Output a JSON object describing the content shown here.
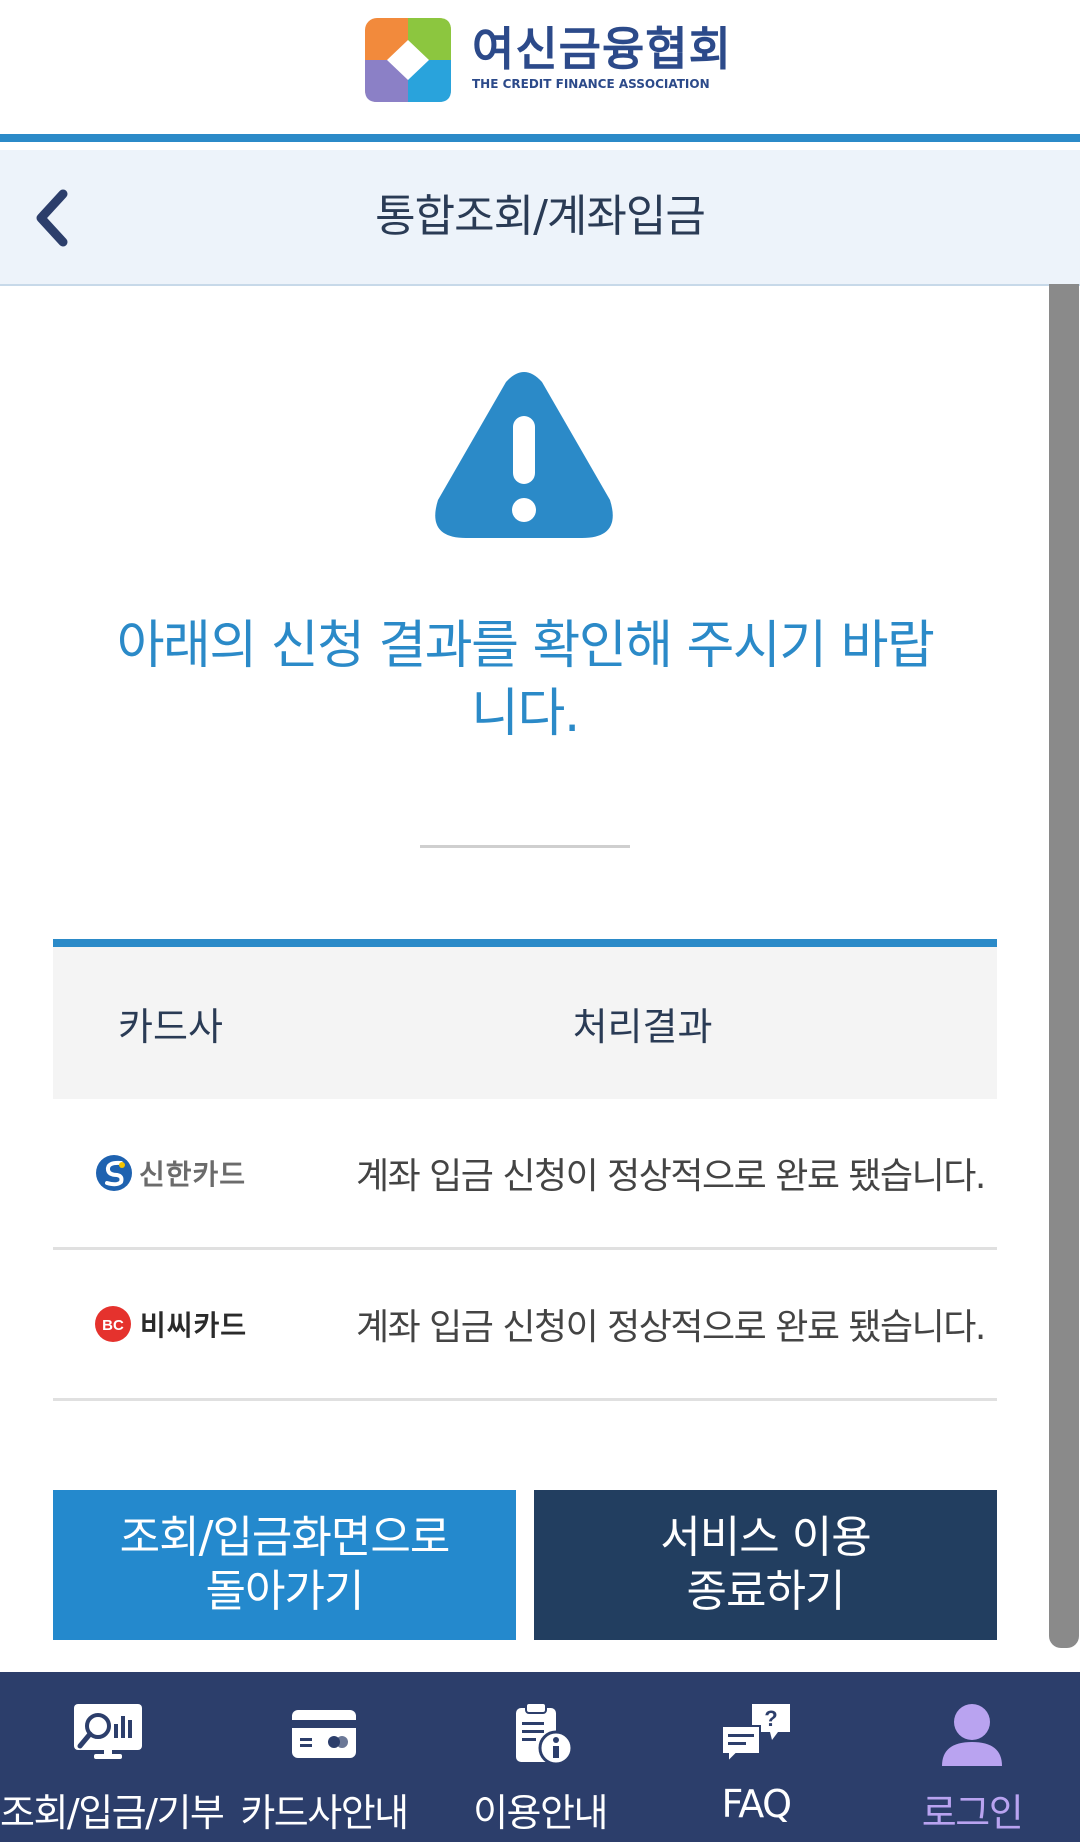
{
  "header": {
    "logo_text_kr": "여신금융협회",
    "logo_text_en": "THE CREDIT FINANCE ASSOCIATION"
  },
  "titlebar": {
    "title": "통합조회/계좌입금"
  },
  "main": {
    "message": "아래의 신청 결과를 확인해 주시기 바랍니다."
  },
  "table": {
    "headers": {
      "company": "카드사",
      "result": "처리결과"
    },
    "rows": [
      {
        "company": "신한카드",
        "result": "계좌 입금 신청이 정상적으로 완료 됐습니다."
      },
      {
        "company": "비씨카드",
        "result": "계좌 입금 신청이 정상적으로 완료 됐습니다."
      }
    ]
  },
  "buttons": {
    "back_to_search": "조회/입금화면으로 돌아가기",
    "end_service": "서비스 이용 종료하기"
  },
  "bottom_nav": {
    "items": [
      {
        "label": "조회/입금/기부",
        "icon": "search-chart-icon"
      },
      {
        "label": "카드사안내",
        "icon": "card-icon"
      },
      {
        "label": "이용안내",
        "icon": "info-clipboard-icon"
      },
      {
        "label": "FAQ",
        "icon": "faq-icon"
      },
      {
        "label": "로그인",
        "icon": "user-icon"
      }
    ]
  },
  "colors": {
    "accent": "#2b8ac8",
    "dark_navy": "#223e60",
    "nav_bg": "#2c3e6b",
    "nav_active": "#b9a3f0",
    "title_bar_bg": "#edf3fa"
  }
}
